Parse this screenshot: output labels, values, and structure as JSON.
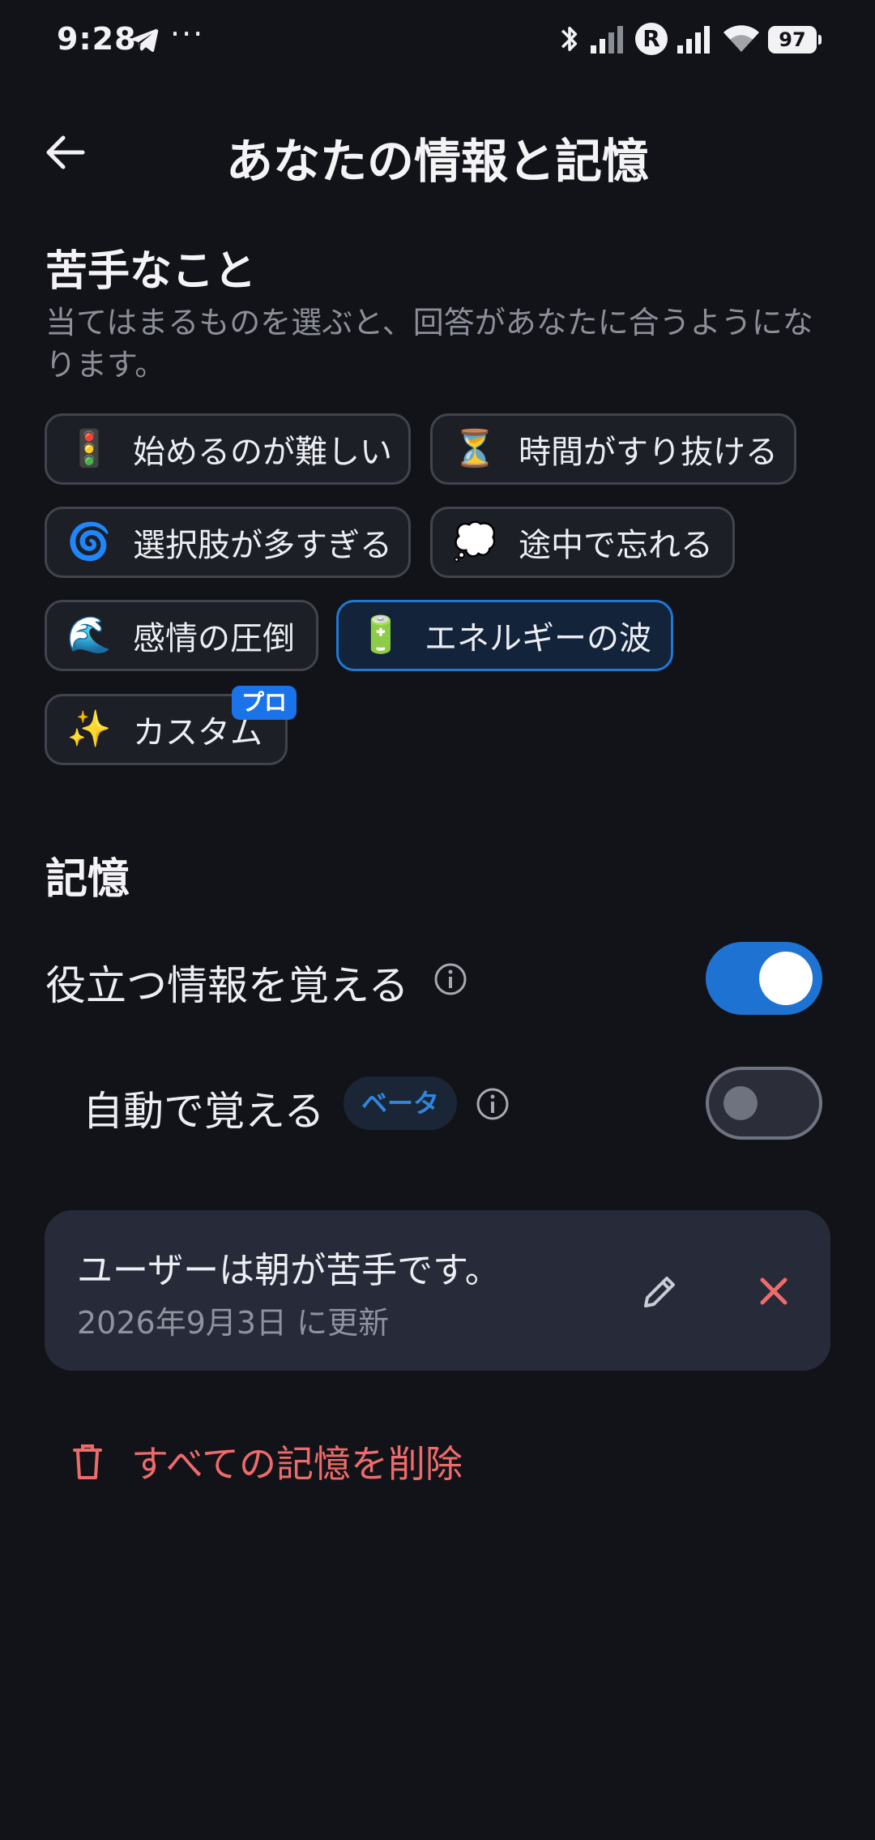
{
  "status_bar": {
    "time": "9:28",
    "more": "···",
    "carrier_badge": "R",
    "battery": "97",
    "icons": [
      "telegram-icon",
      "bluetooth-icon",
      "signal-icon",
      "wifi-icon",
      "battery-icon"
    ]
  },
  "header": {
    "title": "あなたの情報と記憶",
    "back_icon": "arrow-left-icon"
  },
  "difficulties": {
    "title": "苦手なこと",
    "description": "当てはまるものを選ぶと、回答があなたに合うようになります。",
    "chips": [
      {
        "emoji": "🚦",
        "label": "始めるのが難しい",
        "selected": false
      },
      {
        "emoji": "⏳",
        "label": "時間がすり抜ける",
        "selected": false
      },
      {
        "emoji": "🌀",
        "label": "選択肢が多すぎる",
        "selected": false
      },
      {
        "emoji": "💭",
        "label": "途中で忘れる",
        "selected": false
      },
      {
        "emoji": "🌊",
        "label": "感情の圧倒",
        "selected": false
      },
      {
        "emoji": "🔋",
        "label": "エネルギーの波",
        "selected": true
      },
      {
        "emoji": "✨",
        "label": "カスタム",
        "selected": false,
        "badge": "プロ"
      }
    ]
  },
  "memory": {
    "title": "記憶",
    "remember_label": "役立つ情報を覚える",
    "remember_enabled": true,
    "auto_label": "自動で覚える",
    "auto_badge": "ベータ",
    "auto_enabled": false,
    "items": [
      {
        "text": "ユーザーは朝が苦手です。",
        "updated": "2026年9月3日 に更新"
      }
    ],
    "delete_all_label": "すべての記憶を削除"
  },
  "colors": {
    "background": "#121318",
    "accent": "#1e73d2",
    "danger": "#ef6b6b",
    "card": "#272a38"
  }
}
